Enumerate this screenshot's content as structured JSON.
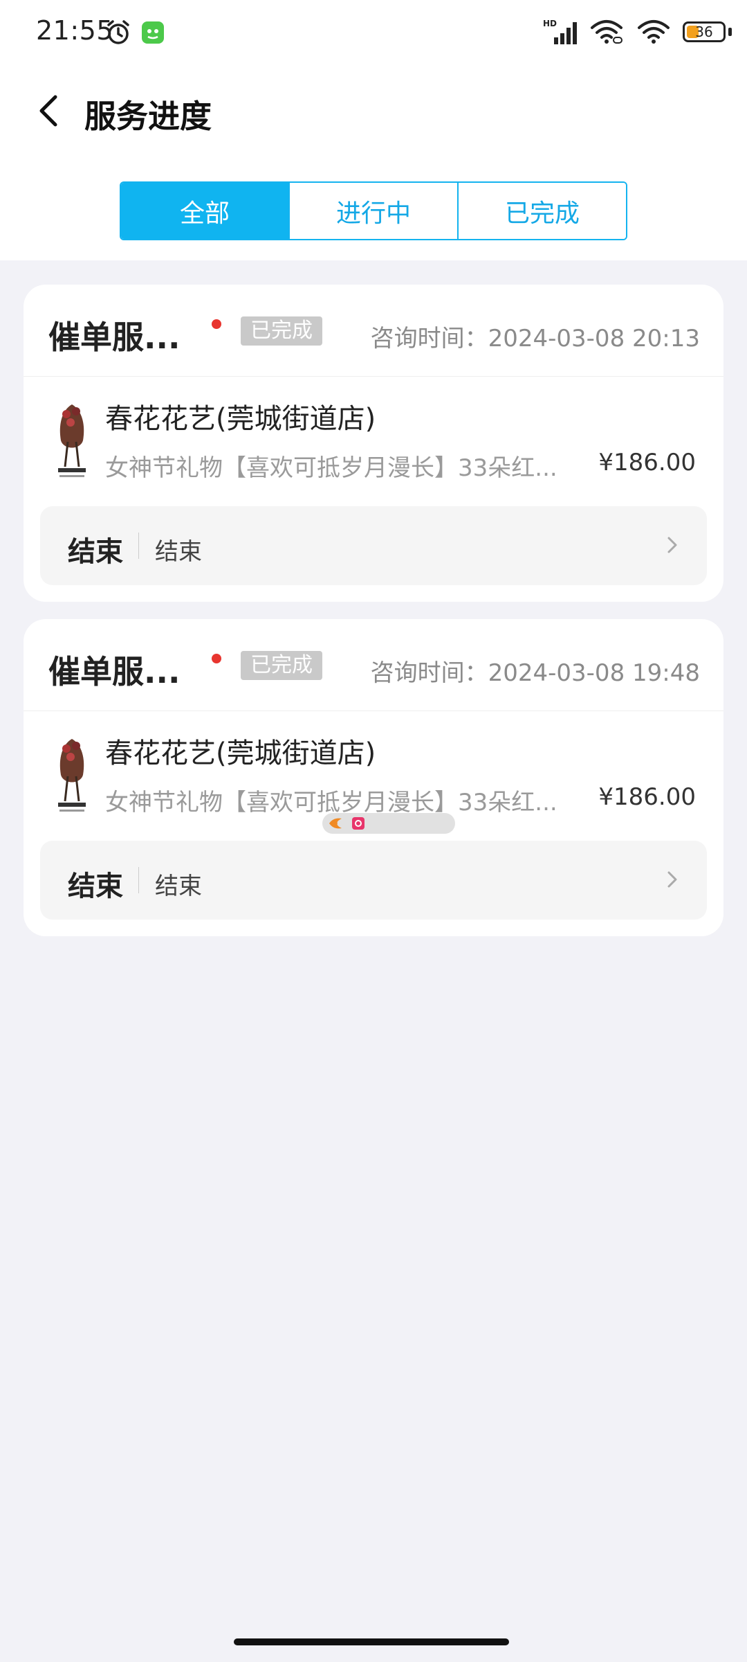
{
  "status_bar": {
    "time": "21:55",
    "network": "HD",
    "battery": "36"
  },
  "header": {
    "title": "服务进度"
  },
  "tabs": [
    {
      "label": "全部",
      "active": true
    },
    {
      "label": "进行中",
      "active": false
    },
    {
      "label": "已完成",
      "active": false
    }
  ],
  "cards": [
    {
      "title": "催单服...",
      "status": "已完成",
      "consult_time": "咨询时间：2024-03-08 20:13",
      "shop_name": "春花花艺(莞城街道店)",
      "product": "女神节礼物【喜欢可抵岁月漫长】33朵红...",
      "price": "¥186.00",
      "result_label": "结束",
      "result_value": "结束"
    },
    {
      "title": "催单服...",
      "status": "已完成",
      "consult_time": "咨询时间：2024-03-08 19:48",
      "shop_name": "春花花艺(莞城街道店)",
      "product": "女神节礼物【喜欢可抵岁月漫长】33朵红...",
      "price": "¥186.00",
      "result_label": "结束",
      "result_value": "结束"
    }
  ],
  "colors": {
    "accent": "#10b4f0",
    "badge_gray": "#c9c9c9",
    "dot_red": "#e8352f",
    "page_bg": "#f2f2f7"
  }
}
